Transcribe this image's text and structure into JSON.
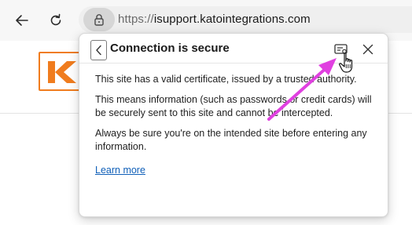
{
  "browser": {
    "url_scheme": "https://",
    "url_host": "isupport.katointegrations.com"
  },
  "popup": {
    "title": "Connection is secure",
    "paragraphs": [
      "This site has a valid certificate, issued by a trusted authority.",
      "This means information (such as passwords or credit cards) will be securely sent to this site and cannot be intercepted.",
      "Always be sure you're on the intended site before entering any information."
    ],
    "learn_more": "Learn more"
  },
  "icons": {
    "back": "arrow-left-icon",
    "refresh": "refresh-icon",
    "site_info": "lock-icon",
    "popup_back": "chevron-left-icon",
    "certificate": "certificate-icon",
    "close": "close-icon",
    "cursor": "hand-pointer-icon",
    "annotation": "annotation-arrow"
  },
  "colors": {
    "accent_link": "#0f5fb8",
    "logo_orange": "#f07c1e",
    "annotation_magenta": "#e040e0"
  }
}
